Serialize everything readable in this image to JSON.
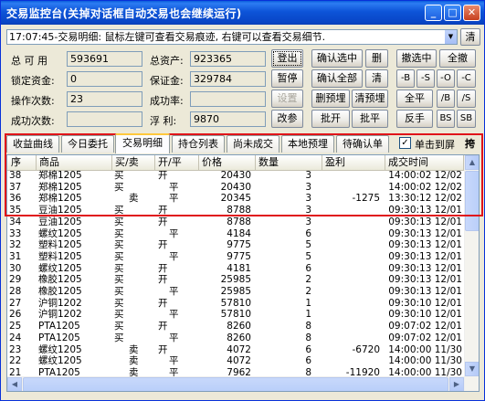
{
  "window": {
    "title": "交易监控台(关掉对话框自动交易也会继续运行)"
  },
  "titlebar": {
    "min_glyph": "_",
    "max_glyph": "□",
    "close_glyph": "✕"
  },
  "message_bar": {
    "text": "17:07:45-交易明细: 鼠标左键可查看交易痕迹, 右键可以查看交易细节.",
    "dropdown_glyph": "▼",
    "clear_label": "清"
  },
  "stats": {
    "total_lots_label": "总 可 用",
    "total_lots_value": "593691",
    "locked_funds_label": "锁定资金:",
    "locked_funds_value": "0",
    "op_count_label": "操作次数:",
    "op_count_value": "23",
    "success_count_label": "成功次数:",
    "success_count_value": "",
    "total_assets_label": "总资产:",
    "total_assets_value": "923365",
    "margin_label": "保证金:",
    "margin_value": "329784",
    "success_rate_label": "成功率:",
    "success_rate_value": "",
    "float_pnl_label": "浮  利:",
    "float_pnl_value": "9870"
  },
  "buttons": {
    "logout": "登出",
    "pause": "暂停",
    "settings": "设置",
    "change_param": "改参",
    "confirm_selected": "确认选中",
    "delete": "删",
    "confirm_all": "确认全部",
    "clear": "清",
    "delete_preorder": "删预埋",
    "clear_preorder": "清预埋",
    "batch_open": "批开",
    "batch_close": "批平",
    "cancel_selected": "撤选中",
    "cancel_all": "全撤",
    "minus_b": "-B",
    "minus_s": "-S",
    "minus_o": "-O",
    "minus_c": "-C",
    "close_all": "全平",
    "slash_b": "/B",
    "slash_s": "/S",
    "reverse": "反手",
    "bs": "BS",
    "sb": "SB"
  },
  "tabs": [
    {
      "label": "收益曲线"
    },
    {
      "label": "今日委托"
    },
    {
      "label": "交易明细"
    },
    {
      "label": "持仓列表"
    },
    {
      "label": "尚未成交"
    },
    {
      "label": "本地预埋"
    },
    {
      "label": "待确认单"
    }
  ],
  "single_click_to_screen": {
    "label": "单击到屏",
    "checked": true,
    "check_glyph": "✓"
  },
  "stick_label": "挎",
  "table": {
    "columns": [
      "序",
      "商品",
      "买/卖",
      "开/平",
      "价格",
      "数量",
      "盈利",
      "成交时间"
    ],
    "rows": [
      [
        "38",
        "郑棉1205",
        "买",
        "开",
        "20430",
        "3",
        "",
        "14:00:02 12/02"
      ],
      [
        "37",
        "郑棉1205",
        "买",
        "平",
        "20430",
        "3",
        "",
        "14:00:02 12/02"
      ],
      [
        "36",
        "郑棉1205",
        "卖",
        "平",
        "20345",
        "3",
        "-1275",
        "13:30:12 12/02"
      ],
      [
        "35",
        "豆油1205",
        "买",
        "开",
        "8788",
        "3",
        "",
        "09:30:13 12/01"
      ],
      [
        "34",
        "豆油1205",
        "买",
        "开",
        "8788",
        "3",
        "",
        "09:30:13 12/01"
      ],
      [
        "33",
        "螺纹1205",
        "买",
        "平",
        "4184",
        "6",
        "",
        "09:30:13 12/01"
      ],
      [
        "32",
        "塑料1205",
        "买",
        "开",
        "9775",
        "5",
        "",
        "09:30:13 12/01"
      ],
      [
        "31",
        "塑料1205",
        "买",
        "平",
        "9775",
        "5",
        "",
        "09:30:13 12/01"
      ],
      [
        "30",
        "螺纹1205",
        "买",
        "开",
        "4181",
        "6",
        "",
        "09:30:13 12/01"
      ],
      [
        "29",
        "橡胶1205",
        "买",
        "开",
        "25985",
        "2",
        "",
        "09:30:13 12/01"
      ],
      [
        "28",
        "橡胶1205",
        "买",
        "平",
        "25985",
        "2",
        "",
        "09:30:13 12/01"
      ],
      [
        "27",
        "沪铜1202",
        "买",
        "开",
        "57810",
        "1",
        "",
        "09:30:10 12/01"
      ],
      [
        "26",
        "沪铜1202",
        "买",
        "平",
        "57810",
        "1",
        "",
        "09:30:10 12/01"
      ],
      [
        "25",
        "PTA1205",
        "买",
        "开",
        "8260",
        "8",
        "",
        "09:07:02 12/01"
      ],
      [
        "24",
        "PTA1205",
        "买",
        "平",
        "8260",
        "8",
        "",
        "09:07:02 12/01"
      ],
      [
        "23",
        "螺纹1205",
        "卖",
        "开",
        "4072",
        "6",
        "-6720",
        "14:00:00 11/30"
      ],
      [
        "22",
        "螺纹1205",
        "卖",
        "平",
        "4072",
        "6",
        "",
        "14:00:00 11/30"
      ],
      [
        "21",
        "PTA1205",
        "卖",
        "平",
        "7962",
        "8",
        "-11920",
        "14:00:00 11/30"
      ]
    ]
  },
  "scroll": {
    "up": "▲",
    "down": "▼",
    "left": "◀",
    "right": "▶"
  }
}
